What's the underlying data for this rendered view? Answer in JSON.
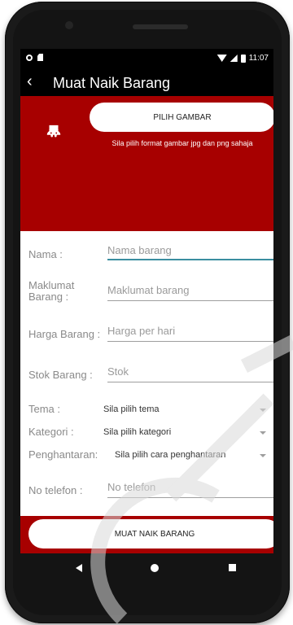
{
  "status_bar": {
    "time": "11:07"
  },
  "app_bar": {
    "back": "‹",
    "title": "Muat Naik Barang"
  },
  "banner": {
    "pick_label": "PILIH GAMBAR",
    "hint": "Sila pilih format gambar jpg dan png sahaja"
  },
  "form": {
    "nama": {
      "label": "Nama :",
      "placeholder": "Nama barang"
    },
    "maklumat": {
      "label": "Maklumat Barang :",
      "placeholder": "Maklumat barang"
    },
    "harga": {
      "label": "Harga Barang :",
      "placeholder": "Harga per hari"
    },
    "stok": {
      "label": "Stok Barang :",
      "placeholder": "Stok"
    },
    "tema": {
      "label": "Tema :",
      "value": "Sila pilih tema"
    },
    "kategori": {
      "label": "Kategori :",
      "value": "Sila pilih kategori"
    },
    "penghantaran": {
      "label": "Penghantaran:",
      "value": "Sila pilih cara penghantaran"
    },
    "telefon": {
      "label": "No telefon :",
      "placeholder": "No telefon"
    }
  },
  "upload_button": {
    "label": "MUAT NAIK BARANG"
  },
  "colors": {
    "primary": "#a70000",
    "accent": "#3a8ea0",
    "bar": "#000000"
  }
}
